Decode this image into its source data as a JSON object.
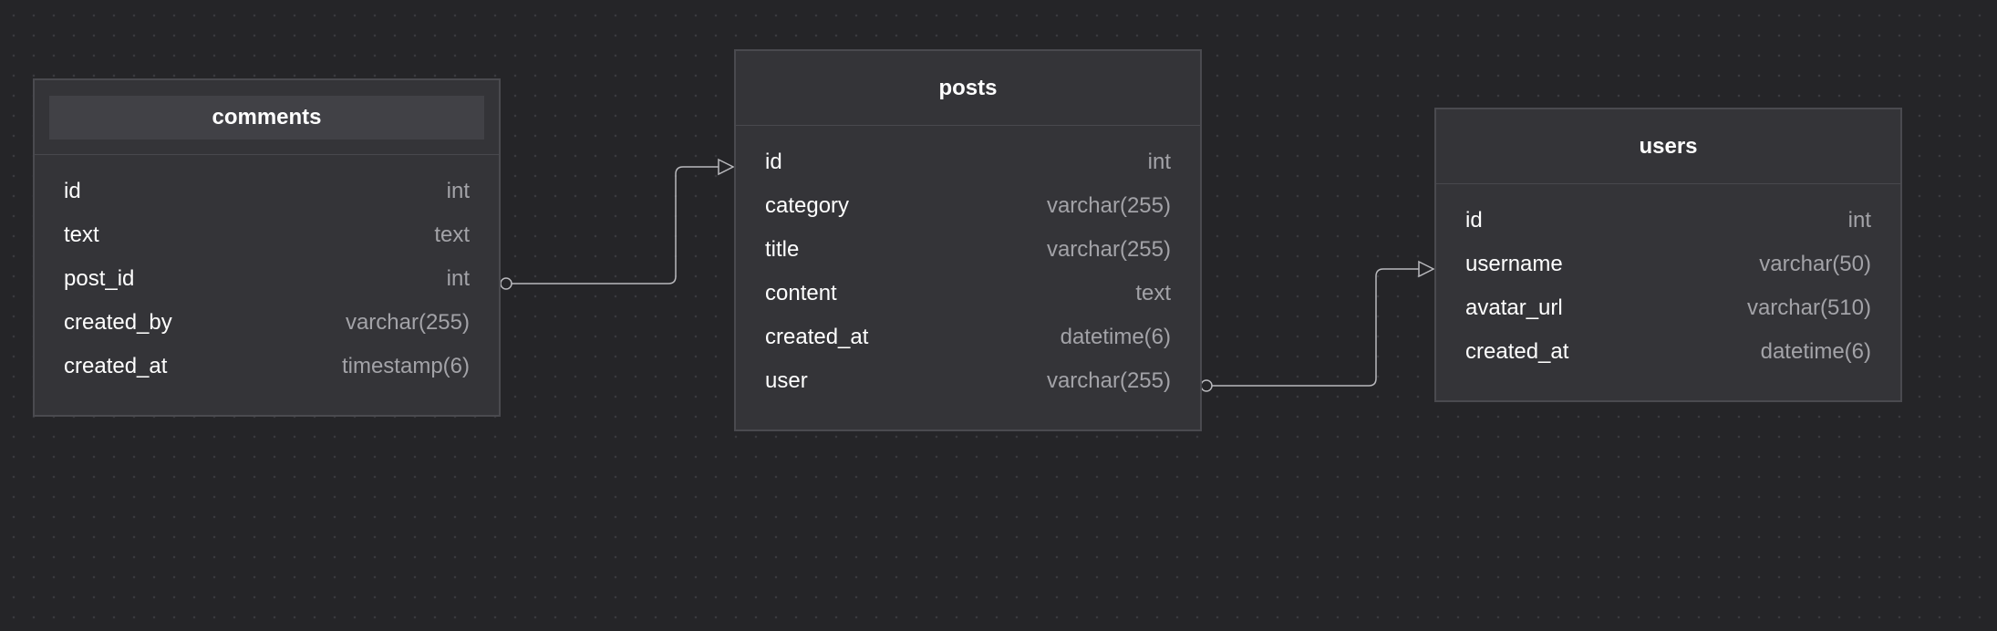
{
  "tables": {
    "comments": {
      "name": "comments",
      "columns": [
        {
          "name": "id",
          "type": "int"
        },
        {
          "name": "text",
          "type": "text"
        },
        {
          "name": "post_id",
          "type": "int"
        },
        {
          "name": "created_by",
          "type": "varchar(255)"
        },
        {
          "name": "created_at",
          "type": "timestamp(6)"
        }
      ]
    },
    "posts": {
      "name": "posts",
      "columns": [
        {
          "name": "id",
          "type": "int"
        },
        {
          "name": "category",
          "type": "varchar(255)"
        },
        {
          "name": "title",
          "type": "varchar(255)"
        },
        {
          "name": "content",
          "type": "text"
        },
        {
          "name": "created_at",
          "type": "datetime(6)"
        },
        {
          "name": "user",
          "type": "varchar(255)"
        }
      ]
    },
    "users": {
      "name": "users",
      "columns": [
        {
          "name": "id",
          "type": "int"
        },
        {
          "name": "username",
          "type": "varchar(50)"
        },
        {
          "name": "avatar_url",
          "type": "varchar(510)"
        },
        {
          "name": "created_at",
          "type": "datetime(6)"
        }
      ]
    }
  },
  "relations": [
    {
      "from_table": "comments",
      "from_column": "post_id",
      "to_table": "posts",
      "to_column": "id"
    },
    {
      "from_table": "posts",
      "from_column": "user",
      "to_table": "users",
      "to_column": "username"
    }
  ],
  "colors": {
    "canvas": "#252528",
    "node_fill": "#343438",
    "node_border": "#4a4a4f",
    "connector": "#b9b9bd",
    "type_text": "#a3a3a8"
  }
}
